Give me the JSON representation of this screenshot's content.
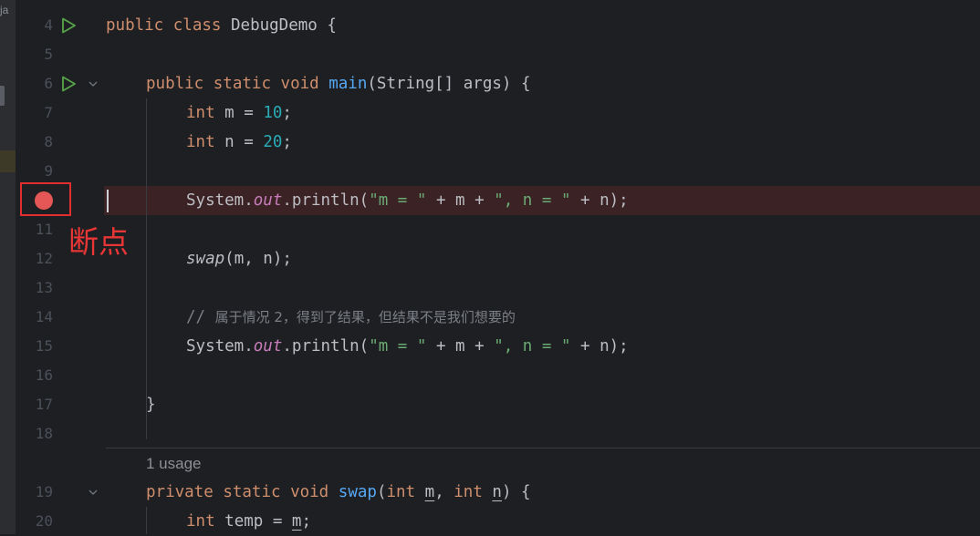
{
  "sidebar": {
    "tab_label": "ja"
  },
  "gutter": {
    "line_numbers": [
      "4",
      "5",
      "6",
      "7",
      "8",
      "9",
      "",
      "11",
      "12",
      "13",
      "14",
      "15",
      "16",
      "17",
      "18",
      "19",
      "20"
    ],
    "annotation": "断点"
  },
  "code": {
    "l4": {
      "kw1": "public",
      "kw2": "class",
      "name": "DebugDemo",
      "brace": "{"
    },
    "l6": {
      "kw1": "public",
      "kw2": "static",
      "kw3": "void",
      "method": "main",
      "params": "(String[] args) {"
    },
    "l7": {
      "type": "int",
      "decl": "m = ",
      "value": "10",
      "semi": ";"
    },
    "l8": {
      "type": "int",
      "decl": "n = ",
      "value": "20",
      "semi": ";"
    },
    "l10": {
      "cls": "System.",
      "field": "out",
      "call": ".println(",
      "s1": "\"m = \"",
      "mid1": " + m + ",
      "s2": "\", n = \"",
      "tail": " + n);"
    },
    "l12": {
      "method": "swap",
      "args": "(m, n);"
    },
    "l14": {
      "comment_prefix": "// ",
      "comment_text": "属于情况 2，得到了结果，但结果不是我们想要的"
    },
    "l15": {
      "cls": "System.",
      "field": "out",
      "call": ".println(",
      "s1": "\"m = \"",
      "mid1": " + m + ",
      "s2": "\", n = \"",
      "tail": " + n);"
    },
    "l17": {
      "brace": "}"
    },
    "usage": "1 usage",
    "l19": {
      "kw1": "private",
      "kw2": "static",
      "kw3": "void",
      "method": "swap",
      "open": "(",
      "t1": "int",
      "p1": "m",
      "comma": ", ",
      "t2": "int",
      "p2": "n",
      "close": ") {"
    },
    "l20": {
      "type": "int",
      "decl": "temp = ",
      "ref": "m",
      "semi": ";"
    }
  },
  "colors": {
    "background": "#1e1f22",
    "keyword": "#cf8e6d",
    "number": "#2aacb8",
    "string": "#6aab73",
    "method": "#56a8f5",
    "static_field": "#c77dbb",
    "comment": "#7a7e85",
    "breakpoint": "#e55757",
    "breakpoint_line": "#3b2225",
    "annotation": "#e83636"
  },
  "icons": {
    "run": "run-triangle-icon",
    "fold": "chevron-down-icon",
    "breakpoint": "breakpoint-icon"
  }
}
